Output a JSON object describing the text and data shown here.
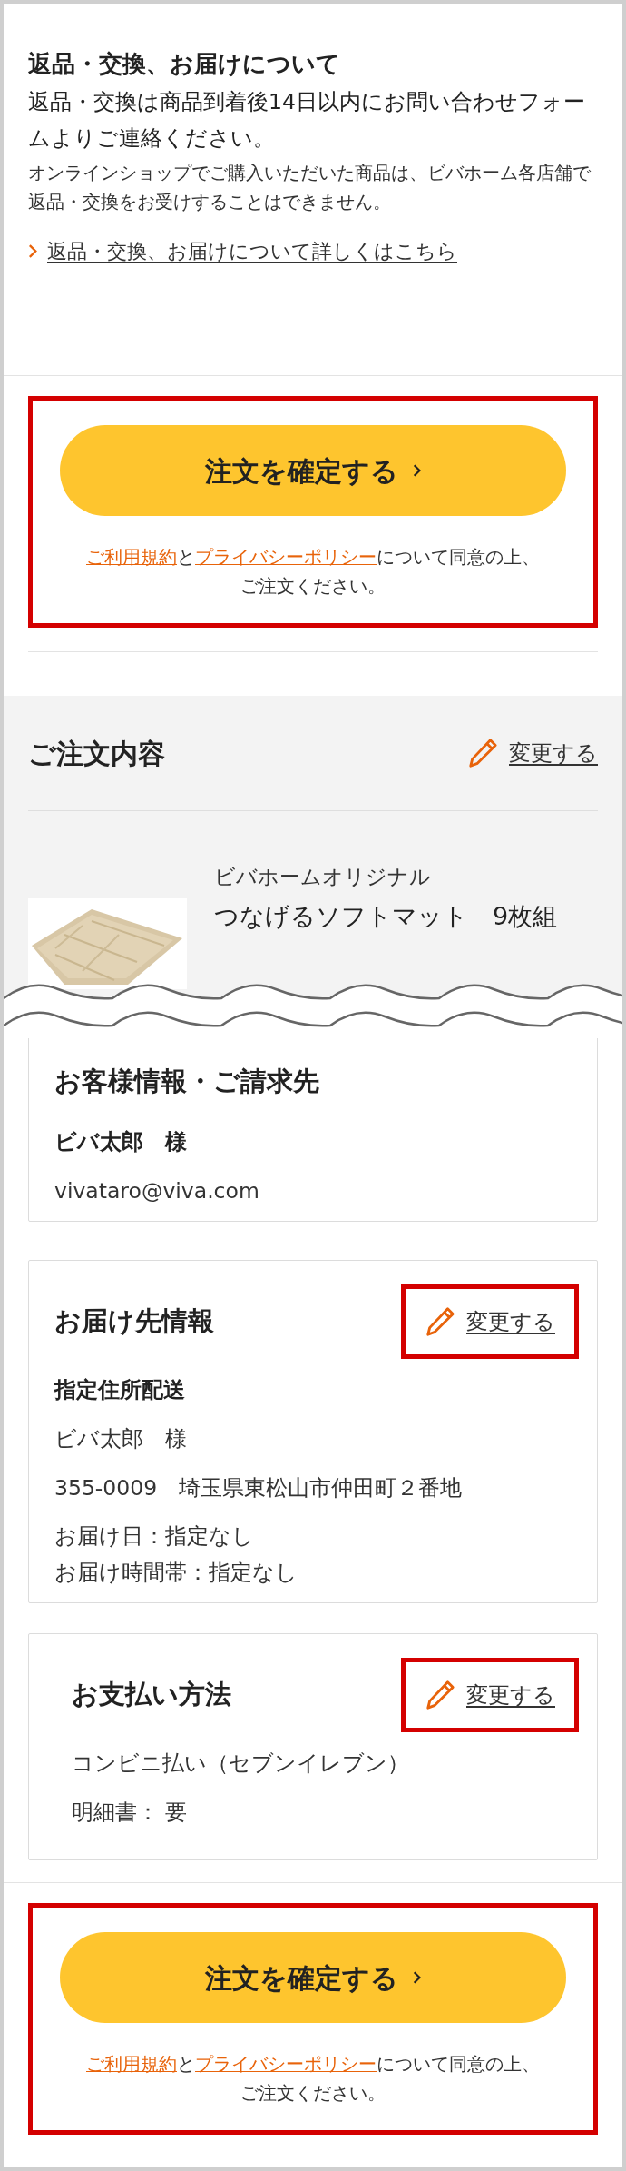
{
  "returns": {
    "title": "返品・交換、お届けについて",
    "text": "返品・交換は商品到着後14日以内にお問い合わせフォームよりご連絡ください。",
    "note": "オンラインショップでご購入いただいた商品は、ビバホーム各店舗で返品・交換をお受けすることはできません。",
    "link": "返品・交換、お届けについて詳しくはこちら"
  },
  "confirm_top": {
    "button": "注文を確定する",
    "terms_link": "ご利用規約",
    "joiner": "と",
    "privacy_link": "プライバシーポリシー",
    "agree_lines": [
      "について同意の上、",
      "ご注文ください。"
    ],
    "highlighted": true
  },
  "order": {
    "title": "ご注文内容",
    "edit": {
      "label": "変更する",
      "highlighted": false
    },
    "items": [
      {
        "brand": "ビバホームオリジナル",
        "name": "つなげるソフトマット　9枚組"
      }
    ]
  },
  "cards": [
    {
      "title": "お客様情報・ご請求先",
      "lines": [
        {
          "kind": "text",
          "text": "ビバ太郎　様",
          "bold": true
        },
        {
          "kind": "text",
          "text": "vivataro@viva.com",
          "bold": false
        }
      ]
    },
    {
      "title": "お届け先情報",
      "edit": {
        "label": "変更する",
        "highlighted": true
      },
      "lines": [
        {
          "kind": "text",
          "text": "指定住所配送",
          "bold": true
        },
        {
          "kind": "text",
          "text": "ビバ太郎　様",
          "bold": false
        },
        {
          "kind": "text",
          "text": "355-0009　埼玉県東松山市仲田町２番地",
          "bold": false
        },
        {
          "kind": "group",
          "texts": [
            "お届け日：指定なし",
            "お届け時間帯：指定なし"
          ]
        }
      ]
    },
    {
      "title": "お支払い方法",
      "edit": {
        "label": "変更する",
        "highlighted": true
      },
      "lines": [
        {
          "kind": "text",
          "text": "コンビニ払い（セブンイレブン）",
          "bold": false
        },
        {
          "kind": "text",
          "text": "明細書：  要",
          "bold": false
        }
      ]
    }
  ],
  "confirm_bottom": {
    "button": "注文を確定する",
    "terms_link": "ご利用規約",
    "joiner": "と",
    "privacy_link": "プライバシーポリシー",
    "agree_lines": [
      "について同意の上、",
      "ご注文ください。"
    ],
    "highlighted": true
  }
}
